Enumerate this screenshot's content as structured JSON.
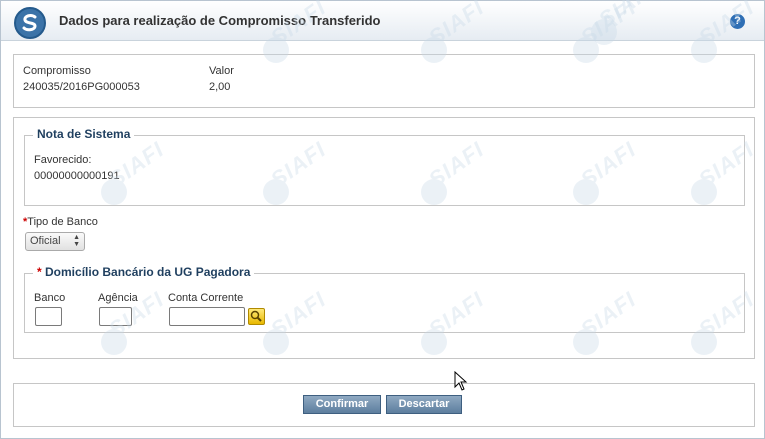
{
  "dialog": {
    "title": "Dados para realização de Compromisso Transferido",
    "help_icon": "help-icon",
    "help_symbol": "?"
  },
  "compromisso": {
    "label": "Compromisso",
    "value": "240035/2016PG000053",
    "valor_label": "Valor",
    "valor_value": "2,00"
  },
  "nota_sistema": {
    "legend": "Nota de Sistema",
    "favorecido_label": "Favorecido:",
    "favorecido_value": "00000000000191"
  },
  "tipo_banco": {
    "required_mark": "*",
    "label": "Tipo de Banco",
    "selected": "Oficial"
  },
  "domicilio": {
    "required_mark": "*",
    "legend": "Domicílio Bancário da UG Pagadora",
    "banco_label": "Banco",
    "agencia_label": "Agência",
    "conta_label": "Conta Corrente",
    "banco_value": "",
    "agencia_value": "",
    "conta_value": ""
  },
  "actions": {
    "confirm_label": "Confirmar",
    "discard_label": "Descartar"
  },
  "watermark": {
    "text": "SIAFI"
  },
  "colors": {
    "title_text": "#333333",
    "legend_text": "#1f3f5f",
    "button_bg": "#6f8fae",
    "required": "#cc0000",
    "search_button": "#f2c400"
  }
}
